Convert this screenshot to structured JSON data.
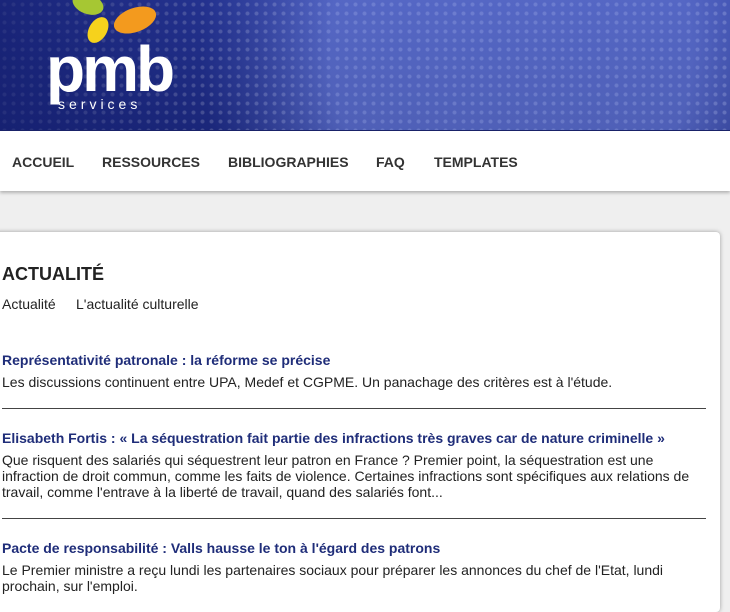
{
  "header": {
    "logo_text": "pmb",
    "logo_subtext": "services",
    "colors": {
      "banner": "#23318a",
      "leaf_green": "#a6c733",
      "leaf_orange": "#f39a1e",
      "leaf_yellow": "#f6d21c"
    }
  },
  "nav": {
    "items": [
      {
        "label": "ACCUEIL"
      },
      {
        "label": "RESSOURCES"
      },
      {
        "label": "BIBLIOGRAPHIES"
      },
      {
        "label": "FAQ"
      },
      {
        "label": "TEMPLATES"
      }
    ]
  },
  "main": {
    "title": "ACTUALITÉ",
    "tabs": [
      {
        "label": "Actualité"
      },
      {
        "label": "L'actualité culturelle"
      }
    ],
    "articles": [
      {
        "title": "Représentativité patronale : la réforme se précise",
        "desc": "Les discussions continuent entre UPA, Medef et CGPME. Un panachage des critères est à l'étude."
      },
      {
        "title": "Elisabeth Fortis : « La séquestration fait partie des infractions très graves car de nature criminelle »",
        "desc": "Que risquent des salariés qui séquestrent leur patron en France ? Premier point, la séquestration est une infraction de droit commun, comme les faits de violence. Certaines infractions sont spécifiques aux relations de travail, comme l'entrave à la liberté de travail, quand des salariés font..."
      },
      {
        "title": "Pacte de responsabilité : Valls hausse le ton à l'égard des patrons",
        "desc": "Le Premier ministre a reçu lundi les partenaires sociaux pour préparer les annonces du chef de l'Etat, lundi prochain, sur l'emploi."
      }
    ]
  }
}
